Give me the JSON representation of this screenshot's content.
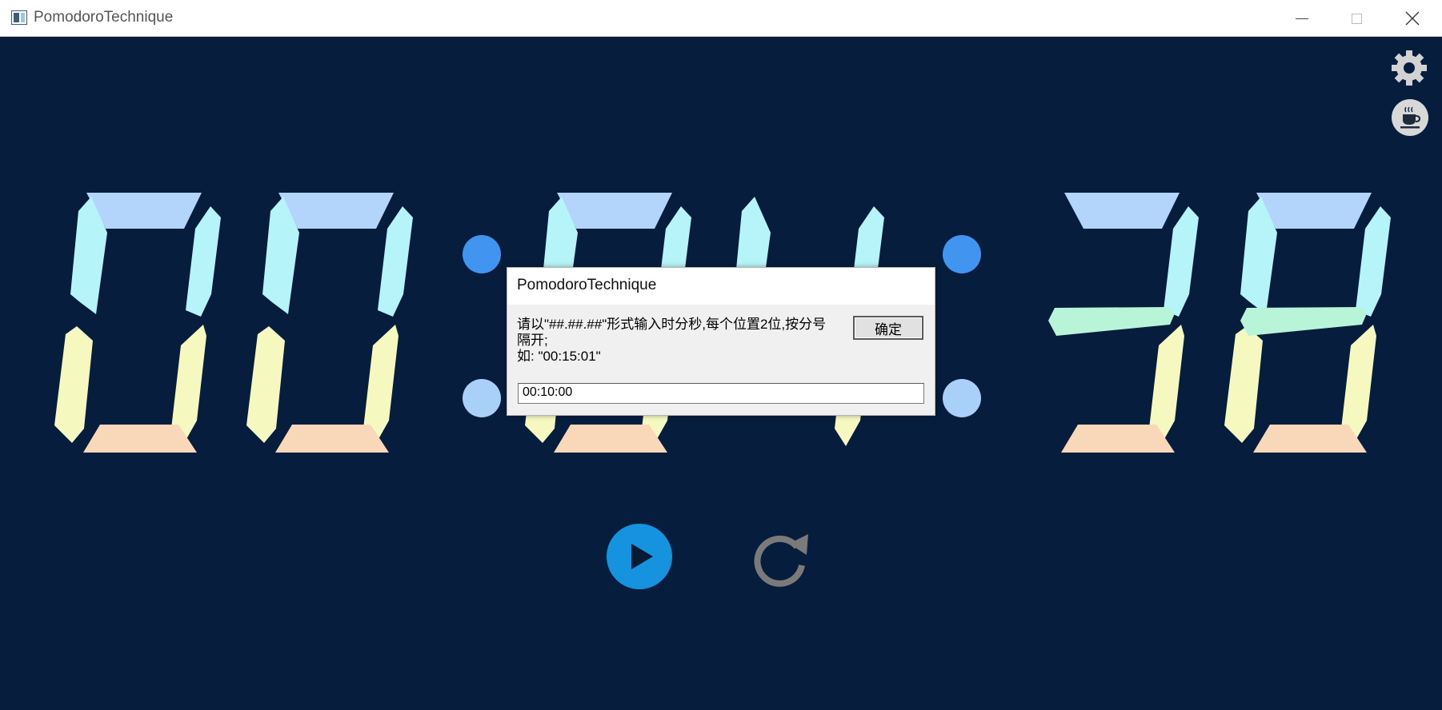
{
  "window": {
    "title": "PomodoroTechnique",
    "minimize_glyph": "—",
    "maximize_glyph": "☐",
    "close_glyph": "✕"
  },
  "clock": {
    "display": "00:04:38",
    "hours": "00",
    "minutes": "04",
    "seconds": "38",
    "colors": {
      "background": "#071d3d",
      "segment_top": "#b3d4fb",
      "segment_upper_sides": "#b5f4f8",
      "segment_middle": "#b8f5d8",
      "segment_lower_sides": "#f5f9c0",
      "segment_bottom": "#f8d8b8",
      "colon_upper": "#4195f0",
      "colon_lower": "#a9d0f8"
    }
  },
  "toolbar": {
    "settings_icon": "gear-icon",
    "break_icon": "coffee-cup-icon"
  },
  "controls": {
    "play_icon": "play-icon",
    "reset_icon": "reset-icon",
    "play_color": "#1693de",
    "reset_color": "#7a7a7a"
  },
  "dialog": {
    "title": "PomodoroTechnique",
    "message_line1": "请以\"##.##.##\"形式输入时分秒,每个位置2位,按分号",
    "message_line2": "隔开;",
    "message_line3": "如: \"00:15:01\"",
    "ok_label": "确定",
    "input_value": "00:10:00"
  }
}
